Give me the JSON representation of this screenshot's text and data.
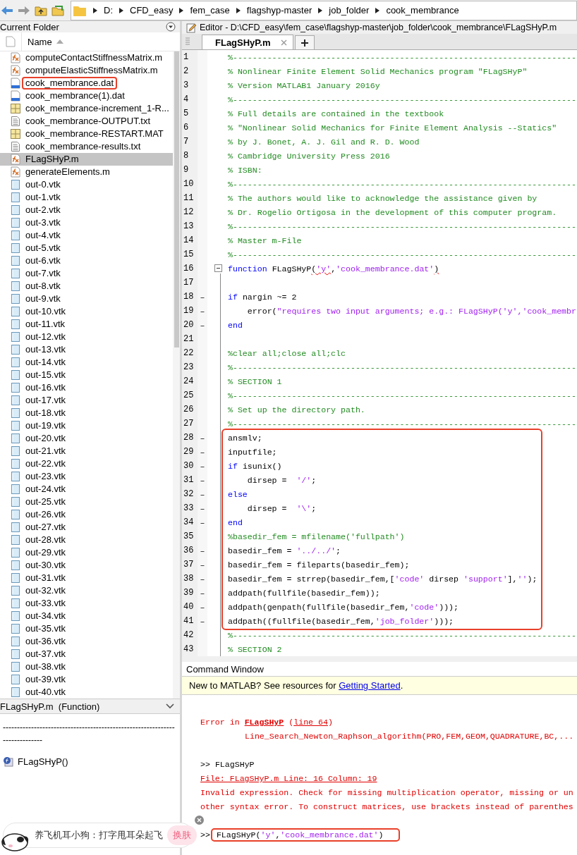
{
  "address_bar": {
    "path": [
      "D:",
      "CFD_easy",
      "fem_case",
      "flagshyp-master",
      "job_folder",
      "cook_membrance"
    ]
  },
  "current_folder": {
    "title": "Current Folder",
    "column": "Name",
    "files": [
      {
        "name": "computeContactStiffnessMatrix.m",
        "kind": "mfile",
        "selected": false,
        "boxed": false
      },
      {
        "name": "computeElasticStiffnessMatrix.m",
        "kind": "mfile",
        "selected": false,
        "boxed": false
      },
      {
        "name": "cook_membrance.dat",
        "kind": "dat",
        "selected": false,
        "boxed": true
      },
      {
        "name": "cook_membrance(1).dat",
        "kind": "dat",
        "selected": false,
        "boxed": false
      },
      {
        "name": "cook_membrance-increment_1-R...",
        "kind": "mat",
        "selected": false,
        "boxed": false
      },
      {
        "name": "cook_membrance-OUTPUT.txt",
        "kind": "txt",
        "selected": false,
        "boxed": false
      },
      {
        "name": "cook_membrance-RESTART.MAT",
        "kind": "mat",
        "selected": false,
        "boxed": false
      },
      {
        "name": "cook_membrance-results.txt",
        "kind": "txt",
        "selected": false,
        "boxed": false
      },
      {
        "name": "FLagSHyP.m",
        "kind": "mfile",
        "selected": true,
        "boxed": false
      },
      {
        "name": "generateElements.m",
        "kind": "mfile",
        "selected": false,
        "boxed": false
      },
      {
        "name": "out-0.vtk",
        "kind": "vtk",
        "selected": false,
        "boxed": false
      },
      {
        "name": "out-1.vtk",
        "kind": "vtk",
        "selected": false,
        "boxed": false
      },
      {
        "name": "out-2.vtk",
        "kind": "vtk",
        "selected": false,
        "boxed": false
      },
      {
        "name": "out-3.vtk",
        "kind": "vtk",
        "selected": false,
        "boxed": false
      },
      {
        "name": "out-4.vtk",
        "kind": "vtk",
        "selected": false,
        "boxed": false
      },
      {
        "name": "out-5.vtk",
        "kind": "vtk",
        "selected": false,
        "boxed": false
      },
      {
        "name": "out-6.vtk",
        "kind": "vtk",
        "selected": false,
        "boxed": false
      },
      {
        "name": "out-7.vtk",
        "kind": "vtk",
        "selected": false,
        "boxed": false
      },
      {
        "name": "out-8.vtk",
        "kind": "vtk",
        "selected": false,
        "boxed": false
      },
      {
        "name": "out-9.vtk",
        "kind": "vtk",
        "selected": false,
        "boxed": false
      },
      {
        "name": "out-10.vtk",
        "kind": "vtk",
        "selected": false,
        "boxed": false
      },
      {
        "name": "out-11.vtk",
        "kind": "vtk",
        "selected": false,
        "boxed": false
      },
      {
        "name": "out-12.vtk",
        "kind": "vtk",
        "selected": false,
        "boxed": false
      },
      {
        "name": "out-13.vtk",
        "kind": "vtk",
        "selected": false,
        "boxed": false
      },
      {
        "name": "out-14.vtk",
        "kind": "vtk",
        "selected": false,
        "boxed": false
      },
      {
        "name": "out-15.vtk",
        "kind": "vtk",
        "selected": false,
        "boxed": false
      },
      {
        "name": "out-16.vtk",
        "kind": "vtk",
        "selected": false,
        "boxed": false
      },
      {
        "name": "out-17.vtk",
        "kind": "vtk",
        "selected": false,
        "boxed": false
      },
      {
        "name": "out-18.vtk",
        "kind": "vtk",
        "selected": false,
        "boxed": false
      },
      {
        "name": "out-19.vtk",
        "kind": "vtk",
        "selected": false,
        "boxed": false
      },
      {
        "name": "out-20.vtk",
        "kind": "vtk",
        "selected": false,
        "boxed": false
      },
      {
        "name": "out-21.vtk",
        "kind": "vtk",
        "selected": false,
        "boxed": false
      },
      {
        "name": "out-22.vtk",
        "kind": "vtk",
        "selected": false,
        "boxed": false
      },
      {
        "name": "out-23.vtk",
        "kind": "vtk",
        "selected": false,
        "boxed": false
      },
      {
        "name": "out-24.vtk",
        "kind": "vtk",
        "selected": false,
        "boxed": false
      },
      {
        "name": "out-25.vtk",
        "kind": "vtk",
        "selected": false,
        "boxed": false
      },
      {
        "name": "out-26.vtk",
        "kind": "vtk",
        "selected": false,
        "boxed": false
      },
      {
        "name": "out-27.vtk",
        "kind": "vtk",
        "selected": false,
        "boxed": false
      },
      {
        "name": "out-28.vtk",
        "kind": "vtk",
        "selected": false,
        "boxed": false
      },
      {
        "name": "out-29.vtk",
        "kind": "vtk",
        "selected": false,
        "boxed": false
      },
      {
        "name": "out-30.vtk",
        "kind": "vtk",
        "selected": false,
        "boxed": false
      },
      {
        "name": "out-31.vtk",
        "kind": "vtk",
        "selected": false,
        "boxed": false
      },
      {
        "name": "out-32.vtk",
        "kind": "vtk",
        "selected": false,
        "boxed": false
      },
      {
        "name": "out-33.vtk",
        "kind": "vtk",
        "selected": false,
        "boxed": false
      },
      {
        "name": "out-34.vtk",
        "kind": "vtk",
        "selected": false,
        "boxed": false
      },
      {
        "name": "out-35.vtk",
        "kind": "vtk",
        "selected": false,
        "boxed": false
      },
      {
        "name": "out-36.vtk",
        "kind": "vtk",
        "selected": false,
        "boxed": false
      },
      {
        "name": "out-37.vtk",
        "kind": "vtk",
        "selected": false,
        "boxed": false
      },
      {
        "name": "out-38.vtk",
        "kind": "vtk",
        "selected": false,
        "boxed": false
      },
      {
        "name": "out-39.vtk",
        "kind": "vtk",
        "selected": false,
        "boxed": false
      },
      {
        "name": "out-40.vtk",
        "kind": "vtk",
        "selected": false,
        "boxed": false
      }
    ]
  },
  "details": {
    "title": "FLagSHyP.m  (Function)",
    "rule": "---------------------------------------------------------------------------",
    "items": [
      {
        "name": "FLagSHyP()"
      }
    ]
  },
  "editor": {
    "title": "Editor - D:\\CFD_easy\\fem_case\\flagshyp-master\\job_folder\\cook_membrance\\FLagSHyP.m",
    "tabs": [
      {
        "label": "FLagSHyP.m",
        "selected": true
      }
    ],
    "lines": [
      {
        "kind": "line",
        "number": "1",
        "tokens": [
          {
            "kind": "comment",
            "text": "%----------------------------------------------------------------------"
          }
        ]
      },
      {
        "kind": "line",
        "number": "2",
        "tokens": [
          {
            "kind": "comment",
            "text": "% Nonlinear Finite Element Solid Mechanics program \"FLagSHyP\""
          }
        ]
      },
      {
        "kind": "line",
        "number": "3",
        "tokens": [
          {
            "kind": "comment",
            "text": "% Version MATLAB1 January 2016y"
          }
        ]
      },
      {
        "kind": "line",
        "number": "4",
        "tokens": [
          {
            "kind": "comment",
            "text": "%----------------------------------------------------------------------"
          }
        ]
      },
      {
        "kind": "line",
        "number": "5",
        "tokens": [
          {
            "kind": "comment",
            "text": "% Full details are contained in the textbook"
          }
        ]
      },
      {
        "kind": "line",
        "number": "6",
        "tokens": [
          {
            "kind": "comment",
            "text": "% \"Nonlinear Solid Mechanics for Finite Element Analysis --Statics\""
          }
        ]
      },
      {
        "kind": "line",
        "number": "7",
        "tokens": [
          {
            "kind": "comment",
            "text": "% by J. Bonet, A. J. Gil and R. D. Wood"
          }
        ]
      },
      {
        "kind": "line",
        "number": "8",
        "tokens": [
          {
            "kind": "comment",
            "text": "% Cambridge University Press 2016"
          }
        ]
      },
      {
        "kind": "line",
        "number": "9",
        "tokens": [
          {
            "kind": "comment",
            "text": "% ISBN:"
          }
        ]
      },
      {
        "kind": "line",
        "number": "10",
        "tokens": [
          {
            "kind": "comment",
            "text": "%----------------------------------------------------------------------"
          }
        ]
      },
      {
        "kind": "line",
        "number": "11",
        "tokens": [
          {
            "kind": "comment",
            "text": "% The authors would like to acknowledge the assistance given by"
          }
        ]
      },
      {
        "kind": "line",
        "number": "12",
        "tokens": [
          {
            "kind": "comment",
            "text": "% Dr. Rogelio Ortigosa in the development of this computer program."
          }
        ]
      },
      {
        "kind": "line",
        "number": "13",
        "tokens": [
          {
            "kind": "comment",
            "text": "%----------------------------------------------------------------------"
          }
        ]
      },
      {
        "kind": "line",
        "number": "14",
        "tokens": [
          {
            "kind": "comment",
            "text": "% Master m-File"
          }
        ]
      },
      {
        "kind": "line",
        "number": "15",
        "tokens": [
          {
            "kind": "comment",
            "text": "%----------------------------------------------------------------------"
          }
        ]
      },
      {
        "kind": "line",
        "number": "16",
        "foldable": true,
        "tokens": [
          {
            "kind": "keyword",
            "text": "function"
          },
          {
            "kind": "plain",
            "text": " FLagSHyP"
          },
          {
            "kind": "squiggle",
            "text": "("
          },
          {
            "kind": "string_squiggle",
            "text": "'y'"
          },
          {
            "kind": "plain",
            "text": ","
          },
          {
            "kind": "string",
            "text": "'cook_membrance.dat'"
          },
          {
            "kind": "squiggle",
            "text": ")"
          }
        ]
      },
      {
        "kind": "line",
        "number": "17"
      },
      {
        "kind": "line",
        "number": "18",
        "marker": "–",
        "tokens": [
          {
            "kind": "keyword",
            "text": "if"
          },
          {
            "kind": "plain",
            "text": " nargin ~= 2"
          }
        ]
      },
      {
        "kind": "line",
        "number": "19",
        "marker": "–",
        "tokens": [
          {
            "kind": "plain",
            "text": "    error("
          },
          {
            "kind": "string",
            "text": "\"requires two input arguments; e.g.: FLagSHyP('y','cook_membr"
          }
        ]
      },
      {
        "kind": "line",
        "number": "20",
        "marker": "–",
        "tokens": [
          {
            "kind": "keyword",
            "text": "end"
          }
        ]
      },
      {
        "kind": "line",
        "number": "21"
      },
      {
        "kind": "line",
        "number": "22",
        "tokens": [
          {
            "kind": "comment",
            "text": "%clear all;close all;clc"
          }
        ]
      },
      {
        "kind": "line",
        "number": "23",
        "tokens": [
          {
            "kind": "comment",
            "text": "%----------------------------------------------------------------------"
          }
        ]
      },
      {
        "kind": "line",
        "number": "24",
        "tokens": [
          {
            "kind": "comment",
            "text": "% SECTION 1"
          }
        ]
      },
      {
        "kind": "line",
        "number": "25",
        "tokens": [
          {
            "kind": "comment",
            "text": "%----------------------------------------------------------------------"
          }
        ]
      },
      {
        "kind": "line",
        "number": "26",
        "tokens": [
          {
            "kind": "comment",
            "text": "% Set up the directory path."
          }
        ]
      },
      {
        "kind": "line",
        "number": "27",
        "tokens": [
          {
            "kind": "comment",
            "text": "%----------------------------------------------------------------------"
          }
        ]
      },
      {
        "kind": "boxed_group",
        "lines": [
          {
            "kind": "line",
            "number": "28",
            "marker": "–",
            "tokens": [
              {
                "kind": "plain",
                "text": "ansmlv;"
              }
            ]
          },
          {
            "kind": "line",
            "number": "29",
            "marker": "–",
            "tokens": [
              {
                "kind": "plain",
                "text": "inputfile;"
              }
            ]
          },
          {
            "kind": "line",
            "number": "30",
            "marker": "–",
            "tokens": [
              {
                "kind": "keyword",
                "text": "if"
              },
              {
                "kind": "plain",
                "text": " isunix()"
              }
            ]
          },
          {
            "kind": "line",
            "number": "31",
            "marker": "–",
            "tokens": [
              {
                "kind": "plain",
                "text": "    dirsep =  "
              },
              {
                "kind": "string",
                "text": "'/'"
              },
              {
                "kind": "plain",
                "text": ";"
              }
            ]
          },
          {
            "kind": "line",
            "number": "32",
            "marker": "–",
            "tokens": [
              {
                "kind": "keyword",
                "text": "else"
              }
            ]
          },
          {
            "kind": "line",
            "number": "33",
            "marker": "–",
            "tokens": [
              {
                "kind": "plain",
                "text": "    dirsep =  "
              },
              {
                "kind": "string",
                "text": "'\\'"
              },
              {
                "kind": "plain",
                "text": ";"
              }
            ]
          },
          {
            "kind": "line",
            "number": "34",
            "marker": "–",
            "tokens": [
              {
                "kind": "keyword",
                "text": "end"
              }
            ]
          },
          {
            "kind": "line",
            "number": "35",
            "tokens": [
              {
                "kind": "comment",
                "text": "%basedir_fem = mfilename('fullpath')"
              }
            ]
          },
          {
            "kind": "line",
            "number": "36",
            "marker": "–",
            "tokens": [
              {
                "kind": "plain",
                "text": "basedir_fem = "
              },
              {
                "kind": "string",
                "text": "'../../'"
              },
              {
                "kind": "plain",
                "text": ";"
              }
            ]
          },
          {
            "kind": "line",
            "number": "37",
            "marker": "–",
            "tokens": [
              {
                "kind": "plain",
                "text": "basedir_fem = fileparts(basedir_fem);"
              }
            ]
          },
          {
            "kind": "line",
            "number": "38",
            "marker": "–",
            "tokens": [
              {
                "kind": "plain",
                "text": "basedir_fem = strrep(basedir_fem,["
              },
              {
                "kind": "string",
                "text": "'code'"
              },
              {
                "kind": "plain",
                "text": " dirsep "
              },
              {
                "kind": "string",
                "text": "'support'"
              },
              {
                "kind": "plain",
                "text": "],"
              },
              {
                "kind": "string",
                "text": "''"
              },
              {
                "kind": "plain",
                "text": ");"
              }
            ]
          },
          {
            "kind": "line",
            "number": "39",
            "marker": "–",
            "tokens": [
              {
                "kind": "plain",
                "text": "addpath(fullfile(basedir_fem));"
              }
            ]
          },
          {
            "kind": "line",
            "number": "40",
            "marker": "–",
            "tokens": [
              {
                "kind": "plain",
                "text": "addpath(genpath(fullfile(basedir_fem,"
              },
              {
                "kind": "string",
                "text": "'code'"
              },
              {
                "kind": "plain",
                "text": ")));"
              }
            ]
          },
          {
            "kind": "line",
            "number": "41",
            "marker": "–",
            "tokens": [
              {
                "kind": "plain",
                "text": "addpath((fullfile(basedir_fem,"
              },
              {
                "kind": "string",
                "text": "'job_folder'"
              },
              {
                "kind": "plain",
                "text": ")));"
              }
            ]
          }
        ]
      },
      {
        "kind": "line",
        "number": "42",
        "tokens": [
          {
            "kind": "comment",
            "text": "%----------------------------------------------------------------------"
          }
        ]
      },
      {
        "kind": "line",
        "number": "43",
        "tokens": [
          {
            "kind": "comment",
            "text": "% SECTION 2"
          }
        ]
      }
    ]
  },
  "command_window": {
    "title": "Command Window",
    "banner": {
      "text": "New to MATLAB? See resources for ",
      "link": "Getting Started",
      "end": "."
    },
    "lines": [
      {
        "kind": "blank"
      },
      {
        "kind": "error",
        "indent": false,
        "parts": [
          {
            "kind": "plain",
            "text": "Error in "
          },
          {
            "kind": "bold_link",
            "text": "FLagSHyP"
          },
          {
            "kind": "plain",
            "text": " ("
          },
          {
            "kind": "link",
            "text": "line 64"
          },
          {
            "kind": "plain",
            "text": ")"
          }
        ]
      },
      {
        "kind": "error",
        "indent": true,
        "parts": [
          {
            "kind": "plain",
            "text": "Line_Search_Newton_Raphson_algorithm(PRO,FEM,GEOM,QUADRATURE,BC,..."
          }
        ]
      },
      {
        "kind": "blank"
      },
      {
        "kind": "prompt",
        "prompt": ">>",
        "boxed": false,
        "parts": [
          {
            "kind": "plain",
            "text": "FLagSHyP"
          }
        ]
      },
      {
        "kind": "error",
        "indent": false,
        "parts": [
          {
            "kind": "link",
            "text": "File: FLagSHyP.m Line: 16 Column: 19"
          }
        ]
      },
      {
        "kind": "error",
        "indent": false,
        "parts": [
          {
            "kind": "plain",
            "text": "Invalid expression. Check for missing multiplication operator, missing or un"
          }
        ]
      },
      {
        "kind": "error",
        "indent": false,
        "parts": [
          {
            "kind": "plain",
            "text": "other syntax error. To construct matrices, use brackets instead of parenthes"
          }
        ]
      },
      {
        "kind": "blank"
      },
      {
        "kind": "prompt",
        "prompt": ">>",
        "boxed": true,
        "parts": [
          {
            "kind": "plain",
            "text": "FLagSHyP("
          },
          {
            "kind": "string",
            "text": "'y'"
          },
          {
            "kind": "plain",
            "text": ","
          },
          {
            "kind": "string",
            "text": "'cook_membrance.dat'"
          },
          {
            "kind": "plain",
            "text": ")"
          }
        ]
      }
    ]
  },
  "chat_popup": {
    "text": "养飞机耳小狗：打字甩耳朵起飞",
    "button": "换肤"
  }
}
